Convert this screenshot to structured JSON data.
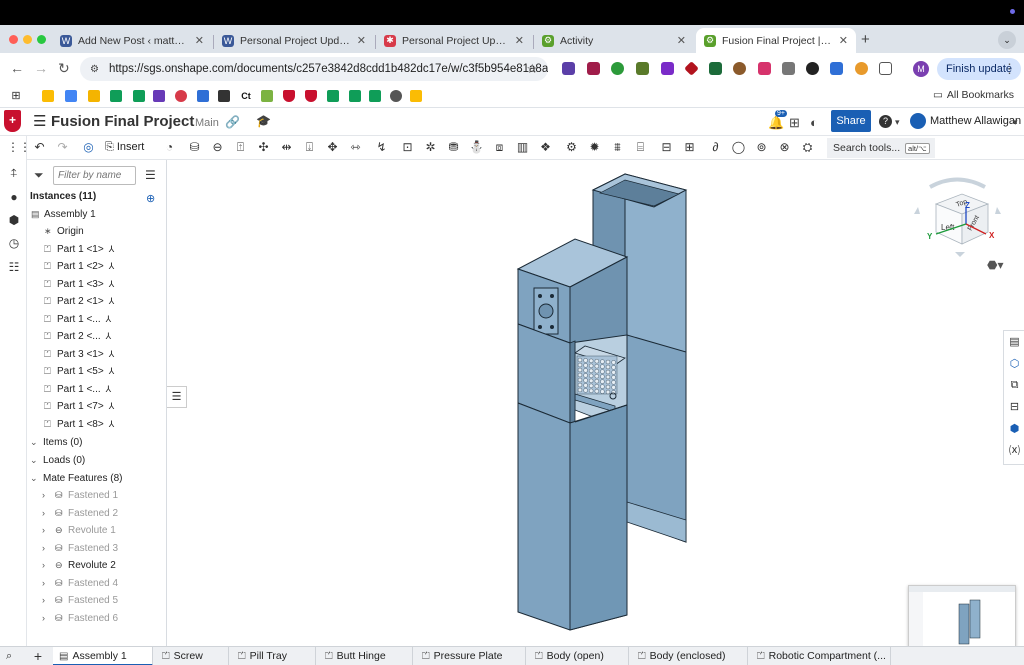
{
  "browser": {
    "tabs": [
      {
        "label": "Add New Post ‹ matthewa — W",
        "fav_color": "#3b5998",
        "fav_glyph": "W"
      },
      {
        "label": "Personal Project Update – jos",
        "fav_color": "#3b5998",
        "fav_glyph": "W"
      },
      {
        "label": "Personal Project Update",
        "fav_color": "#d73a49",
        "fav_glyph": "✱"
      },
      {
        "label": "Activity",
        "fav_color": "#5aa02c",
        "fav_glyph": "⚙"
      },
      {
        "label": "Fusion Final Project | Assemb",
        "fav_color": "#5aa02c",
        "fav_glyph": "⚙"
      }
    ],
    "url": "https://sgs.onshape.com/documents/c257e3842d8cdd1b482dc17e/w/c3f5b954e81a8a67...",
    "finish_update": "Finish update",
    "profile_initial": "M",
    "all_bookmarks": "All Bookmarks",
    "bookmarks_ct": "Ct",
    "bookmarks_w": "W",
    "colors": {
      "accent": "#1a5fb4",
      "onshape_red": "#c8102e"
    }
  },
  "onshape": {
    "doc_title": "Fusion Final Project",
    "branch": "Main",
    "notif_badge": "9+",
    "share": "Share",
    "user": "Matthew Allawigan",
    "insert": "Insert",
    "search_tools": "Search tools...",
    "search_kbd1": "alt/⌥",
    "search_kbd2": "c",
    "filter_placeholder": "Filter by name",
    "instances_header": "Instances (11)",
    "assembly": "Assembly 1",
    "origin": "Origin",
    "instances": [
      "Part 1 <1>",
      "Part 1 <2>",
      "Part 1 <3>",
      "Part 2 <1>",
      "Part 1 <...",
      "Part 2 <...",
      "Part 3 <1>",
      "Part 1 <5>",
      "Part 1 <...",
      "Part 1 <7>",
      "Part 1 <8>"
    ],
    "items": "Items (0)",
    "loads": "Loads (0)",
    "mate_features": "Mate Features (8)",
    "mates": [
      {
        "label": "Fastened 1",
        "muted": true
      },
      {
        "label": "Fastened 2",
        "muted": true
      },
      {
        "label": "Revolute 1",
        "muted": true
      },
      {
        "label": "Fastened 3",
        "muted": true
      },
      {
        "label": "Revolute 2",
        "muted": false
      },
      {
        "label": "Fastened 4",
        "muted": true
      },
      {
        "label": "Fastened 5",
        "muted": true
      },
      {
        "label": "Fastened 6",
        "muted": true
      }
    ],
    "viewcube": {
      "top": "Top",
      "front": "Front",
      "left": "Left",
      "axis_x": "X",
      "axis_y": "Y",
      "axis_z": "Z"
    },
    "bottom_tabs": [
      "Assembly 1",
      "Screw",
      "Pill Tray",
      "Butt Hinge",
      "Pressure Plate",
      "Body (open)",
      "Body (enclosed)",
      "Robotic Compartment (..."
    ],
    "model_color": "#7fa3c0"
  }
}
